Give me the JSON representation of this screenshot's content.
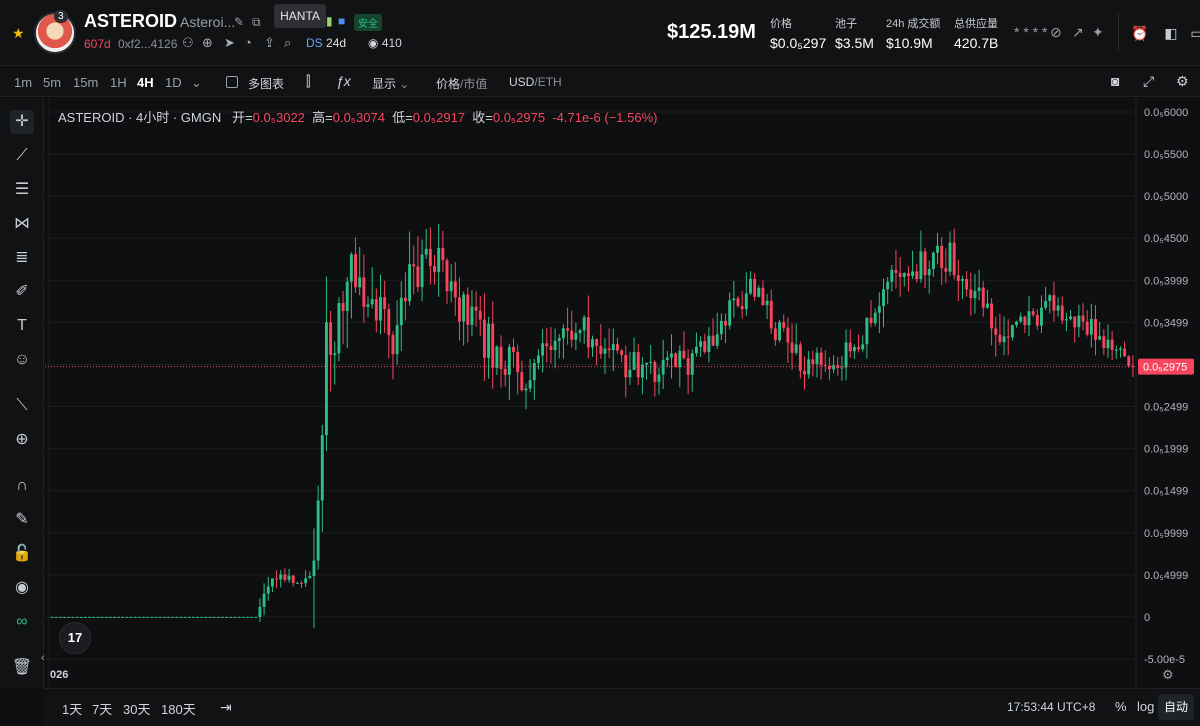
{
  "header": {
    "avatar_badge": "3",
    "name": "ASTEROID",
    "full_name": "Asteroi...",
    "tooltip": "HANTA",
    "safe_label": "安全",
    "age": "607d",
    "address": "0xf2...4126",
    "ds_label": "DS",
    "ds_age": "24d",
    "views": "410",
    "market_cap": "$125.19M",
    "stats": [
      {
        "label": "价格",
        "value": "$0.0₅297"
      },
      {
        "label": "池子",
        "value": "$3.5M"
      },
      {
        "label": "24h 成交额",
        "value": "$10.9M"
      },
      {
        "label": "总供应量",
        "value": "420.7B"
      }
    ],
    "hidden": "* * * *"
  },
  "toolbar": {
    "timeframes": [
      "1m",
      "5m",
      "15m",
      "1H",
      "4H",
      "1D"
    ],
    "active_timeframe": "4H",
    "multi_chart": "多图表",
    "display": "显示",
    "price": "价格",
    "mcap": "市值",
    "usd": "USD",
    "eth": "ETH"
  },
  "legend": {
    "title": "ASTEROID · 4小时 · GMGN",
    "open_label": "开=",
    "open": "0.0₅3022",
    "high_label": "高=",
    "high": "0.0₅3074",
    "low_label": "低=",
    "low": "0.0₅2917",
    "close_label": "收=",
    "close": "0.0₅2975",
    "change": "-4.71e-6 (−1.56%)"
  },
  "chart_data": {
    "type": "candlestick",
    "title": "ASTEROID · 4小时 · GMGN",
    "y_tick_labels": [
      "0.0₅6000",
      "0.0₅5500",
      "0.0₅5000",
      "0.0₅4500",
      "0.0₅3999",
      "0.0₅3499",
      "0.0₅2999",
      "0.0₅2499",
      "0.0₅1999",
      "0.0₅1499",
      "0.0₅9999",
      "0.0₅4999",
      "0",
      "-5.00e-5"
    ],
    "current_price_label": "0.0₅2975",
    "current_price": 29.75,
    "ylim": [
      -5,
      60
    ],
    "x_label_visible": "026",
    "up_color": "#2ebd85",
    "down_color": "#f6465d",
    "segments": [
      {
        "n": 50,
        "start": 0,
        "end": 0,
        "vol": 0
      },
      {
        "n": 5,
        "start": 0,
        "end": 5,
        "vol": 1
      },
      {
        "n": 8,
        "start": 5,
        "end": 4.5,
        "vol": 0.8
      },
      {
        "n": 4,
        "start": 4.5,
        "end": 30,
        "vol": 6
      },
      {
        "n": 6,
        "start": 30,
        "end": 42,
        "vol": 4
      },
      {
        "n": 10,
        "start": 42,
        "end": 33,
        "vol": 3
      },
      {
        "n": 8,
        "start": 33,
        "end": 45,
        "vol": 3
      },
      {
        "n": 10,
        "start": 45,
        "end": 35,
        "vol": 2.5
      },
      {
        "n": 14,
        "start": 35,
        "end": 28,
        "vol": 2.5
      },
      {
        "n": 10,
        "start": 28,
        "end": 35,
        "vol": 2
      },
      {
        "n": 18,
        "start": 35,
        "end": 29,
        "vol": 2
      },
      {
        "n": 14,
        "start": 29,
        "end": 31,
        "vol": 2
      },
      {
        "n": 12,
        "start": 31,
        "end": 39,
        "vol": 2
      },
      {
        "n": 12,
        "start": 39,
        "end": 30,
        "vol": 2
      },
      {
        "n": 10,
        "start": 30,
        "end": 30,
        "vol": 1.5
      },
      {
        "n": 14,
        "start": 30,
        "end": 41,
        "vol": 2
      },
      {
        "n": 12,
        "start": 41,
        "end": 43,
        "vol": 2
      },
      {
        "n": 14,
        "start": 43,
        "end": 33,
        "vol": 2
      },
      {
        "n": 10,
        "start": 33,
        "end": 37,
        "vol": 1.5
      },
      {
        "n": 14,
        "start": 37,
        "end": 33,
        "vol": 1.5
      },
      {
        "n": 6,
        "start": 33,
        "end": 29.75,
        "vol": 1
      }
    ]
  },
  "icons": {
    "star": "★",
    "pencil": "✎",
    "copy": "⧉",
    "globe": "⊕",
    "telegram": "➤",
    "search": "⌕",
    "eye": "◉",
    "camera": "⌘",
    "expand": "⤢"
  },
  "bottom": {
    "ranges": [
      "1天",
      "7天",
      "30天",
      "180天"
    ],
    "clock": "17:53:44 UTC+8",
    "percent": "%",
    "log": "log",
    "auto": "自动"
  }
}
